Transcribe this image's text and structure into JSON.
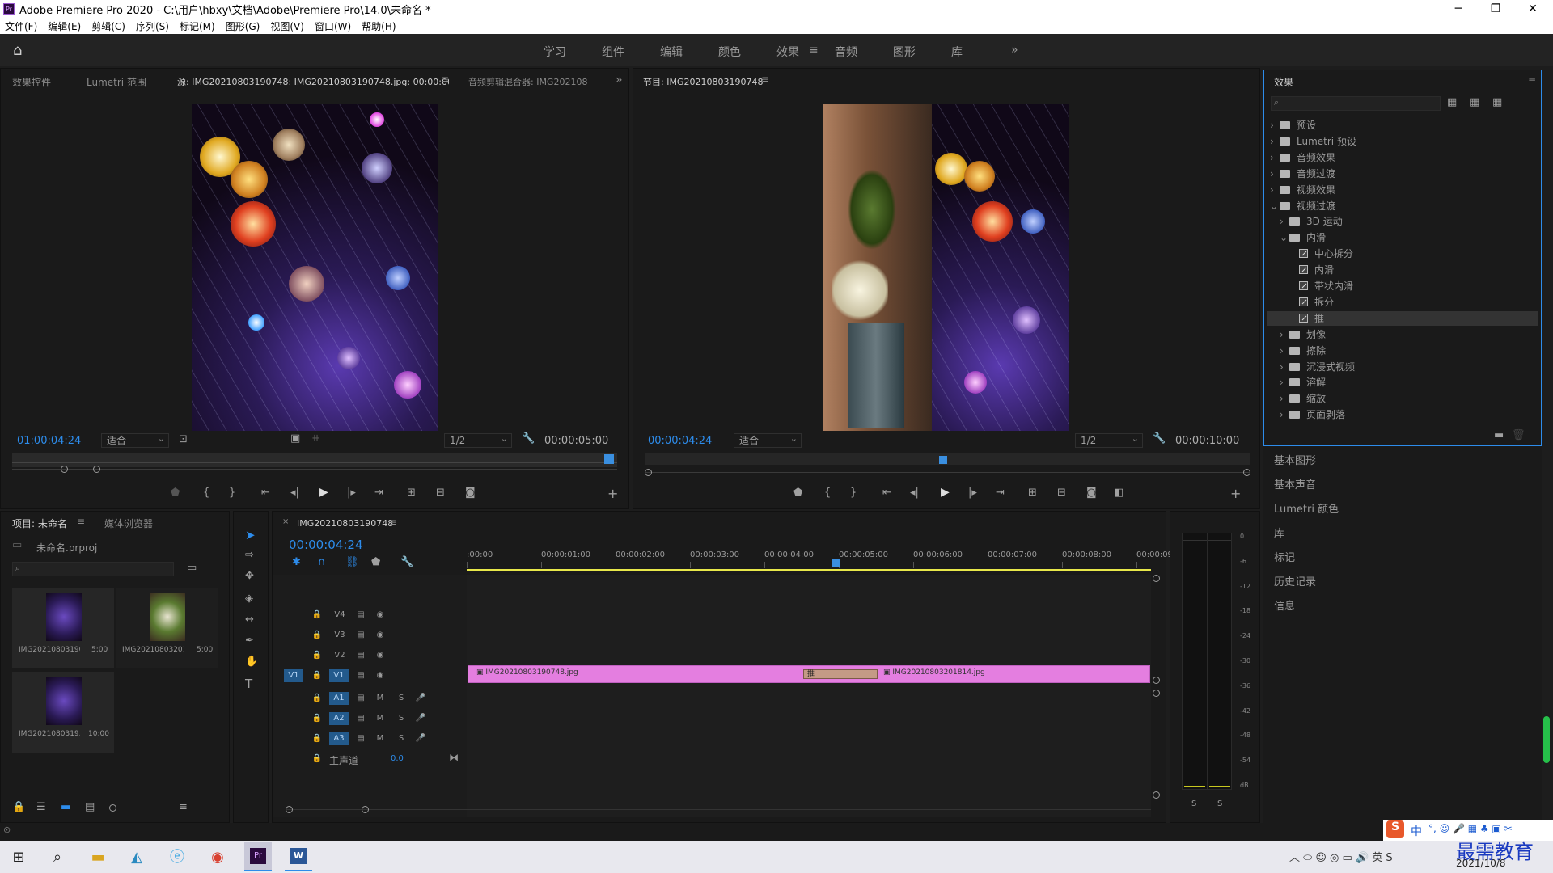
{
  "window": {
    "title": "Adobe Premiere Pro 2020 - C:\\用户\\hbxy\\文档\\Adobe\\Premiere Pro\\14.0\\未命名 *",
    "minimize": "─",
    "maximize": "❐",
    "close": "✕"
  },
  "menu": [
    "文件(F)",
    "编辑(E)",
    "剪辑(C)",
    "序列(S)",
    "标记(M)",
    "图形(G)",
    "视图(V)",
    "窗口(W)",
    "帮助(H)"
  ],
  "workspaces": {
    "tabs": [
      "学习",
      "组件",
      "编辑",
      "颜色",
      "效果",
      "音频",
      "图形",
      "库"
    ],
    "active": "效果",
    "overflow": "»"
  },
  "source_panel": {
    "tabs": [
      "效果控件",
      "Lumetri 范围",
      "源: IMG20210803190748: IMG20210803190748.jpg: 00:00:00:00",
      "音频剪辑混合器: IMG202108"
    ],
    "timecode": "01:00:04:24",
    "fit": "适合",
    "resolution": "1/2",
    "duration": "00:00:05:00"
  },
  "program_panel": {
    "tab": "节目: IMG20210803190748",
    "timecode": "00:00:04:24",
    "fit": "适合",
    "resolution": "1/2",
    "duration": "00:00:10:00"
  },
  "effects_panel": {
    "title": "效果",
    "tree": [
      {
        "label": "预设",
        "depth": 0,
        "type": "folder",
        "expanded": false
      },
      {
        "label": "Lumetri 预设",
        "depth": 0,
        "type": "folder",
        "expanded": false
      },
      {
        "label": "音频效果",
        "depth": 0,
        "type": "folder",
        "expanded": false
      },
      {
        "label": "音频过渡",
        "depth": 0,
        "type": "folder",
        "expanded": false
      },
      {
        "label": "视频效果",
        "depth": 0,
        "type": "folder",
        "expanded": false
      },
      {
        "label": "视频过渡",
        "depth": 0,
        "type": "folder",
        "expanded": true
      },
      {
        "label": "3D 运动",
        "depth": 1,
        "type": "folder",
        "expanded": false
      },
      {
        "label": "内滑",
        "depth": 1,
        "type": "folder",
        "expanded": true
      },
      {
        "label": "中心拆分",
        "depth": 2,
        "type": "effect"
      },
      {
        "label": "内滑",
        "depth": 2,
        "type": "effect"
      },
      {
        "label": "带状内滑",
        "depth": 2,
        "type": "effect"
      },
      {
        "label": "拆分",
        "depth": 2,
        "type": "effect"
      },
      {
        "label": "推",
        "depth": 2,
        "type": "effect",
        "selected": true
      },
      {
        "label": "划像",
        "depth": 1,
        "type": "folder",
        "expanded": false
      },
      {
        "label": "擦除",
        "depth": 1,
        "type": "folder",
        "expanded": false
      },
      {
        "label": "沉浸式视频",
        "depth": 1,
        "type": "folder",
        "expanded": false
      },
      {
        "label": "溶解",
        "depth": 1,
        "type": "folder",
        "expanded": false
      },
      {
        "label": "缩放",
        "depth": 1,
        "type": "folder",
        "expanded": false
      },
      {
        "label": "页面剥落",
        "depth": 1,
        "type": "folder",
        "expanded": false
      }
    ]
  },
  "side_panels": [
    "基本图形",
    "基本声音",
    "Lumetri 颜色",
    "库",
    "标记",
    "历史记录",
    "信息"
  ],
  "project_panel": {
    "tabs": [
      "项目: 未命名",
      "媒体浏览器"
    ],
    "file": "未命名.prproj",
    "items": [
      {
        "name": "IMG2021080319​0...",
        "duration": "5:00"
      },
      {
        "name": "IMG20210803201...",
        "duration": "5:00"
      },
      {
        "name": "IMG2021080319...",
        "duration": "10:00"
      }
    ]
  },
  "timeline": {
    "tab": "IMG20210803190748",
    "timecode": "00:00:04:24",
    "ruler": [
      ":00:00",
      "00:00:01:00",
      "00:00:02:00",
      "00:00:03:00",
      "00:00:04:00",
      "00:00:05:00",
      "00:00:06:00",
      "00:00:07:00",
      "00:00:08:00",
      "00:00:09:"
    ],
    "video_tracks": [
      "V4",
      "V3",
      "V2",
      "V1"
    ],
    "audio_tracks": [
      "A1",
      "A2",
      "A3"
    ],
    "source_patch_v": "V1",
    "m_label": "M",
    "s_label": "S",
    "master": {
      "label": "主声道",
      "value": "0.0"
    },
    "clip1": "IMG20210803190748.jpg",
    "clip2": "IMG20210803201814.jpg",
    "transition": "推"
  },
  "audio_meter": {
    "scale": [
      "0",
      "-6",
      "-12",
      "-18",
      "-24",
      "-30",
      "-36",
      "-42",
      "-48",
      "-54",
      "dB"
    ],
    "solo": [
      "S",
      "S"
    ]
  },
  "taskbar": {
    "ime": "中",
    "date": "2021/10/8",
    "watermark": "最需教育"
  },
  "colors": {
    "accent": "#2d8ceb",
    "clip": "#e47ee0",
    "transition": "#c49a86",
    "playhead": "#3a8fe0",
    "workarea": "#e8e84a"
  }
}
